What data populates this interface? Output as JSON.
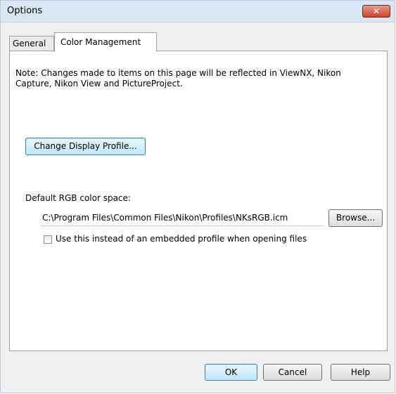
{
  "window": {
    "title": "Options",
    "close_glyph": "✕",
    "close_color": "#c8442f"
  },
  "tabs": [
    {
      "label": "General",
      "active": false
    },
    {
      "label": "Color Management",
      "active": true
    }
  ],
  "panel": {
    "note": "Note: Changes made to items on this page will be reflected in ViewNX, Nikon Capture, Nikon View and PictureProject.",
    "change_display_profile_label": "Change Display Profile...",
    "default_rgb_label": "Default RGB color space:",
    "profile_path": "C:\\Program Files\\Common Files\\Nikon\\Profiles\\NKsRGB.icm",
    "browse_label": "Browse...",
    "embedded_checkbox_label": "Use this instead of an embedded profile when opening files",
    "embedded_checked": false
  },
  "footer": {
    "ok_label": "OK",
    "cancel_label": "Cancel",
    "help_label": "Help"
  }
}
